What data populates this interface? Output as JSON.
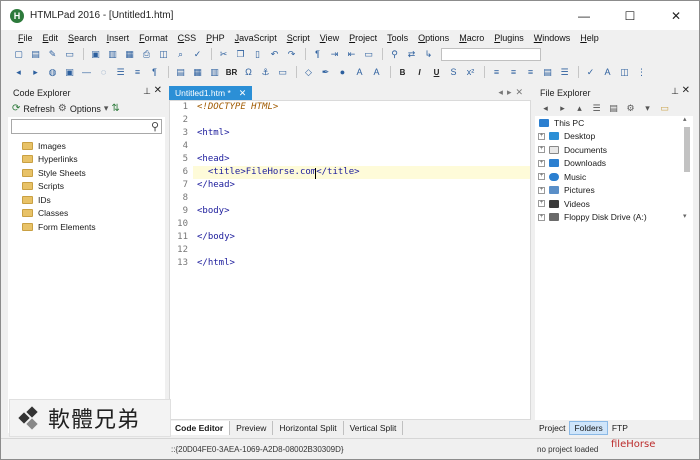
{
  "window": {
    "title": "HTMLPad 2016 - [Untitled1.htm]",
    "controls": {
      "minimize": "—",
      "maximize": "☐",
      "close": "✕"
    }
  },
  "menu": [
    "File",
    "Edit",
    "Search",
    "Insert",
    "Format",
    "CSS",
    "PHP",
    "JavaScript",
    "Script",
    "View",
    "Project",
    "Tools",
    "Options",
    "Macro",
    "Plugins",
    "Windows",
    "Help"
  ],
  "toolbar2_text": {
    "br": "BR",
    "bold": "B",
    "italic": "I",
    "underline": "U"
  },
  "code_explorer": {
    "title": "Code Explorer",
    "refresh": "Refresh",
    "options": "Options",
    "items": [
      "Images",
      "Hyperlinks",
      "Style Sheets",
      "Scripts",
      "IDs",
      "Classes",
      "Form Elements"
    ]
  },
  "editor": {
    "tab_label": "Untitled1.htm *",
    "lines": [
      {
        "n": "1",
        "text": "<!DOCTYPE HTML>"
      },
      {
        "n": "2",
        "text": ""
      },
      {
        "n": "3",
        "text": "<html>"
      },
      {
        "n": "4",
        "text": ""
      },
      {
        "n": "5",
        "text": "<head>"
      },
      {
        "n": "6",
        "text": "  <title>FileHorse.com</title>"
      },
      {
        "n": "7",
        "text": "</head>"
      },
      {
        "n": "8",
        "text": ""
      },
      {
        "n": "9",
        "text": "<body>"
      },
      {
        "n": "10",
        "text": ""
      },
      {
        "n": "11",
        "text": "</body>"
      },
      {
        "n": "12",
        "text": ""
      },
      {
        "n": "13",
        "text": "</html>"
      }
    ],
    "bottom_tabs": [
      "Code Editor",
      "Preview",
      "Horizontal Split",
      "Vertical Split"
    ]
  },
  "file_explorer": {
    "title": "File Explorer",
    "items": [
      {
        "label": "This PC",
        "icon": "computer-icon",
        "color": "#2b7fd0"
      },
      {
        "label": "Desktop",
        "icon": "desktop-icon",
        "color": "#2b8fd6"
      },
      {
        "label": "Documents",
        "icon": "documents-icon",
        "color": "#7a7a7a"
      },
      {
        "label": "Downloads",
        "icon": "downloads-icon",
        "color": "#2b7fd0"
      },
      {
        "label": "Music",
        "icon": "music-icon",
        "color": "#2b7fd0"
      },
      {
        "label": "Pictures",
        "icon": "pictures-icon",
        "color": "#5a8fc8"
      },
      {
        "label": "Videos",
        "icon": "videos-icon",
        "color": "#3a3a3a"
      },
      {
        "label": "Floppy Disk Drive (A:)",
        "icon": "floppy-icon",
        "color": "#6a6a6a"
      }
    ],
    "bottom_tabs": [
      "Project",
      "Folders",
      "FTP"
    ]
  },
  "status": {
    "guid": "::{20D04FE0-3AEA-1069-A2D8-08002B30309D}",
    "project": "no project loaded"
  },
  "watermarks": {
    "left": "軟體兄弟",
    "right": "fileHorse"
  }
}
